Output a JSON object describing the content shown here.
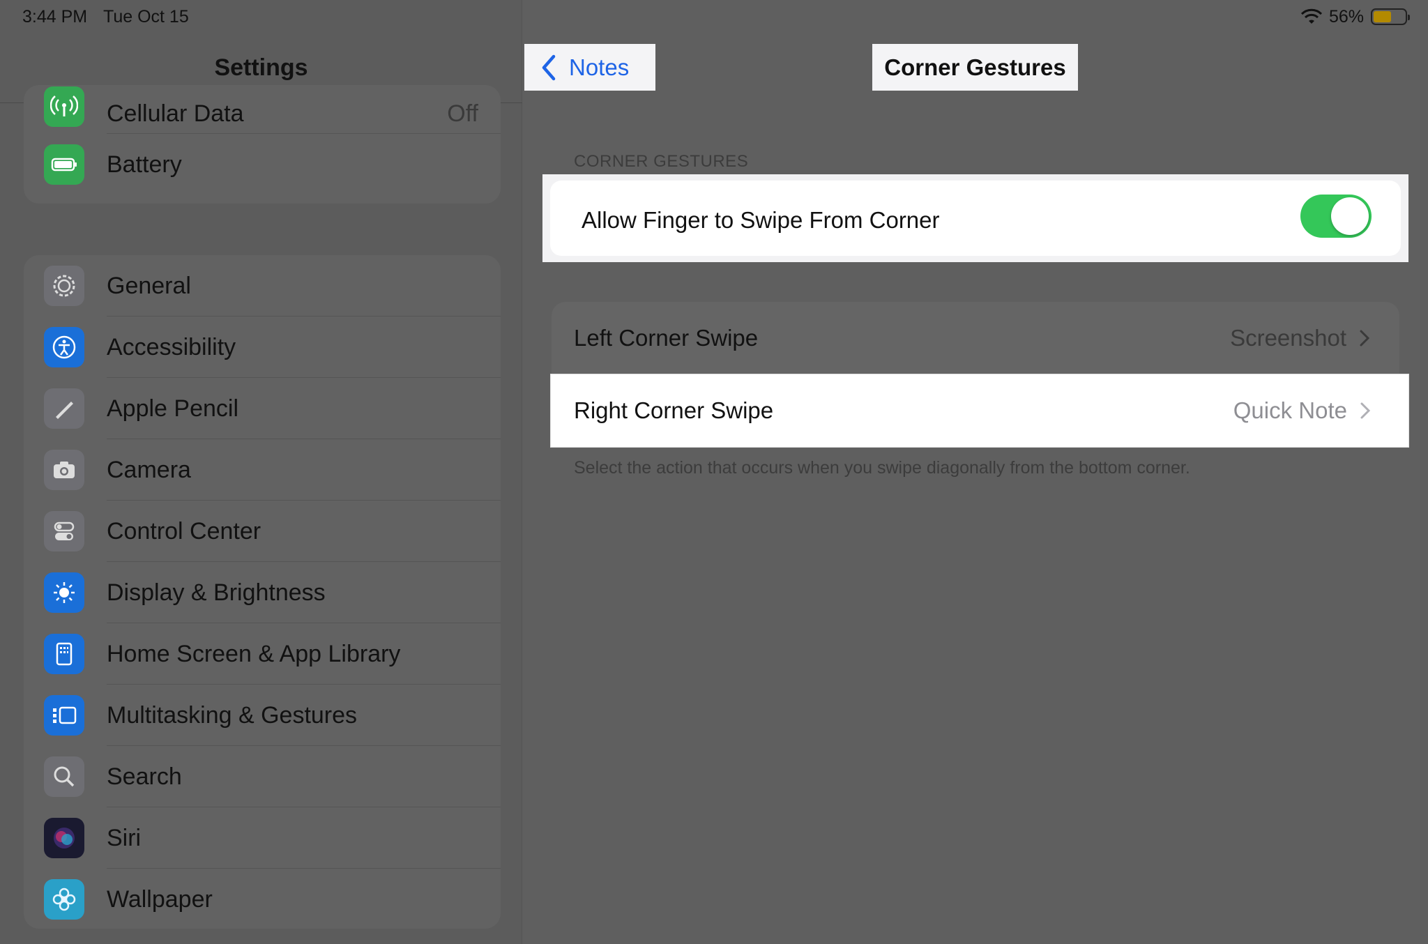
{
  "status_bar": {
    "time": "3:44 PM",
    "date": "Tue Oct 15",
    "battery_percent": "56%",
    "battery_level": 0.56
  },
  "sidebar": {
    "title": "Settings",
    "group1": [
      {
        "label": "Cellular Data",
        "value": "Off",
        "icon": "antenna-icon",
        "color": "#34a853"
      },
      {
        "label": "Battery",
        "icon": "battery-icon",
        "color": "#34a853"
      }
    ],
    "group2": [
      {
        "label": "General",
        "icon": "gear-icon",
        "color": "#6e6e73"
      },
      {
        "label": "Accessibility",
        "icon": "accessibility-icon",
        "color": "#1a6fd8"
      },
      {
        "label": "Apple Pencil",
        "icon": "pencil-icon",
        "color": "#6e6e73"
      },
      {
        "label": "Camera",
        "icon": "camera-icon",
        "color": "#6e6e73"
      },
      {
        "label": "Control Center",
        "icon": "switches-icon",
        "color": "#6e6e73"
      },
      {
        "label": "Display & Brightness",
        "icon": "sun-icon",
        "color": "#1a6fd8"
      },
      {
        "label": "Home Screen & App Library",
        "icon": "home-screen-icon",
        "color": "#1a6fd8"
      },
      {
        "label": "Multitasking & Gestures",
        "icon": "multitasking-icon",
        "color": "#1a6fd8"
      },
      {
        "label": "Search",
        "icon": "magnifier-icon",
        "color": "#6e6e73"
      },
      {
        "label": "Siri",
        "icon": "siri-icon",
        "color": "#2a2a4a"
      },
      {
        "label": "Wallpaper",
        "icon": "flower-icon",
        "color": "#2aa0c8"
      }
    ]
  },
  "nav": {
    "back_label": "Notes",
    "title": "Corner Gestures"
  },
  "content": {
    "section_header": "CORNER GESTURES",
    "toggle_label": "Allow Finger to Swipe From Corner",
    "toggle_on": true,
    "left_swipe_label": "Left Corner Swipe",
    "left_swipe_value": "Screenshot",
    "right_swipe_label": "Right Corner Swipe",
    "right_swipe_value": "Quick Note",
    "footer": "Select the action that occurs when you swipe diagonally from the bottom corner."
  },
  "colors": {
    "accent_blue": "#1e64e6",
    "toggle_green": "#34c759"
  }
}
